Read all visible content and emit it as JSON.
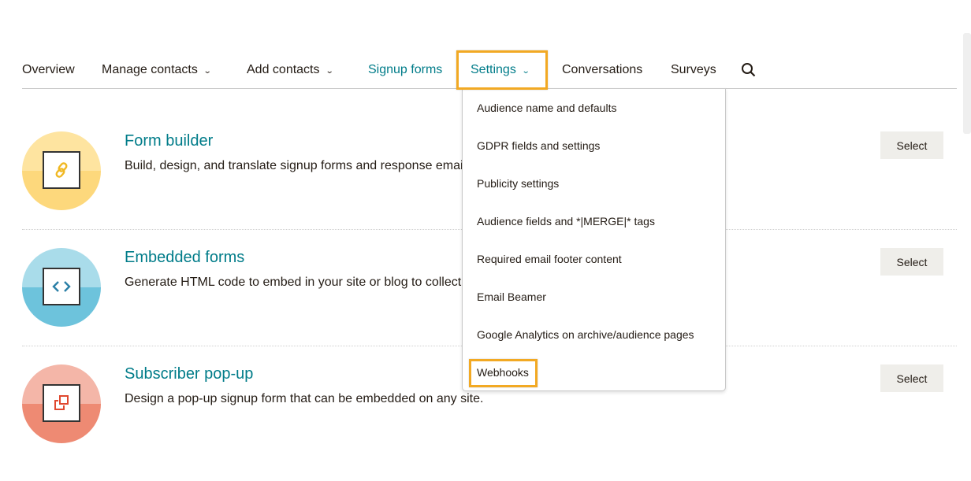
{
  "nav": {
    "overview": "Overview",
    "manage_contacts": "Manage contacts",
    "add_contacts": "Add contacts",
    "signup_forms": "Signup forms",
    "settings": "Settings",
    "conversations": "Conversations",
    "surveys": "Surveys",
    "chevron": "⌄",
    "search_icon": "search-icon"
  },
  "settings_menu": [
    "Audience name and defaults",
    "GDPR fields and settings",
    "Publicity settings",
    "Audience fields and *|MERGE|* tags",
    "Required email footer content",
    "Email Beamer",
    "Google Analytics on archive/audience pages",
    "Webhooks"
  ],
  "rows": [
    {
      "title": "Form builder",
      "desc": "Build, design, and translate signup forms and response emails.",
      "button": "Select",
      "icon": "link-icon"
    },
    {
      "title": "Embedded forms",
      "desc": "Generate HTML code to embed in your site or blog to collect signups.",
      "button": "Select",
      "icon": "code-icon"
    },
    {
      "title": "Subscriber pop-up",
      "desc": "Design a pop-up signup form that can be embedded on any site.",
      "button": "Select",
      "icon": "popup-icon"
    }
  ],
  "colors": {
    "accent": "#007c89",
    "highlight": "#f2a923",
    "yellow_light": "#fee4a0",
    "yellow": "#fdd87c",
    "blue_light": "#a9dcea",
    "blue": "#6dc3dc",
    "red_light": "#f4b6a8",
    "red": "#ee8a73"
  }
}
